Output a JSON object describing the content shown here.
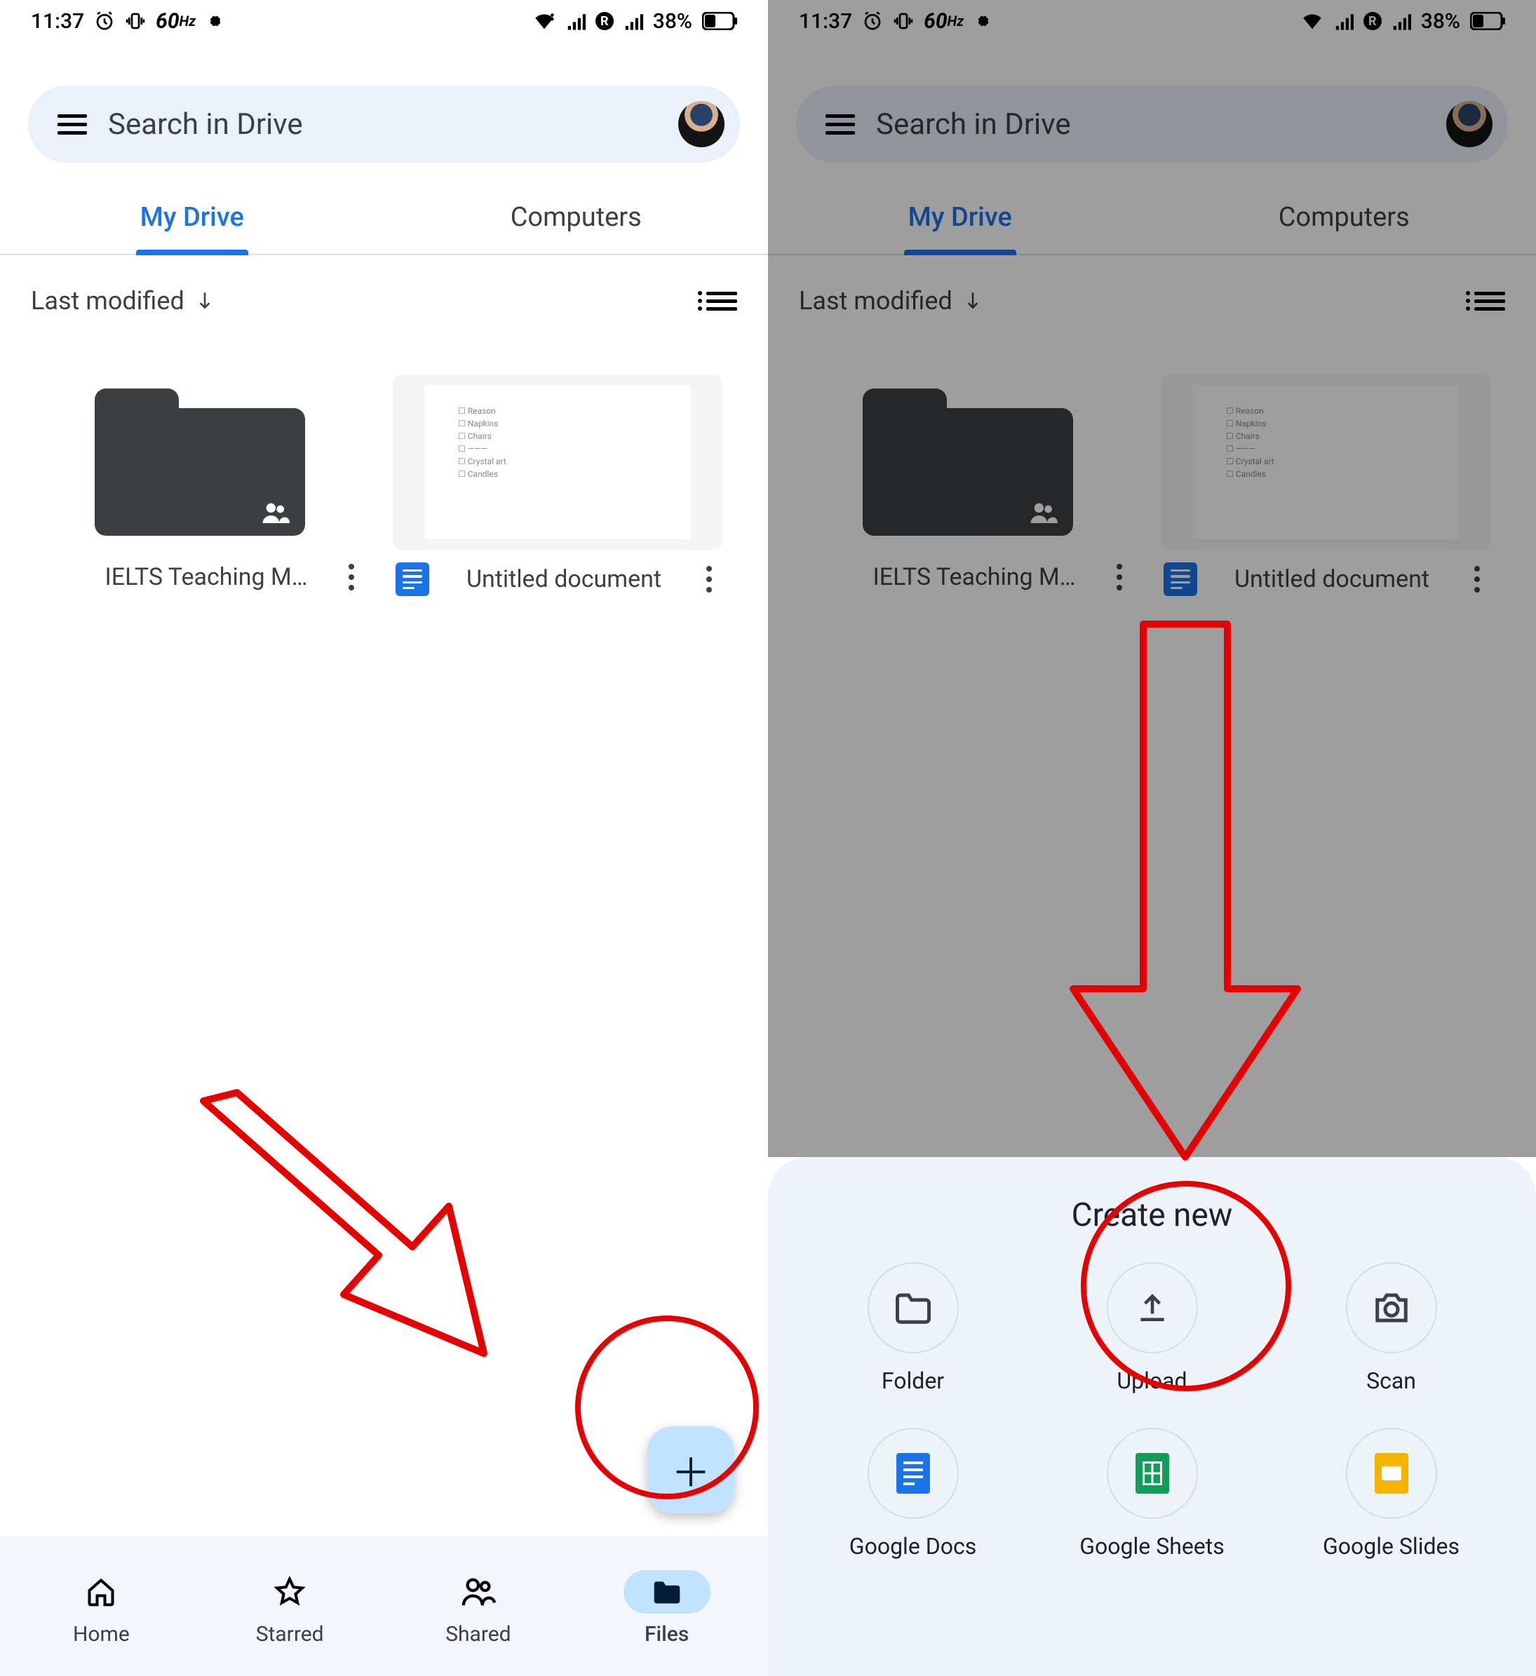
{
  "status": {
    "time": "11:37",
    "refresh_rate": "60",
    "refresh_unit": "Hz",
    "roaming": "R",
    "battery_pct": "38%"
  },
  "search": {
    "placeholder": "Search in Drive"
  },
  "tabs": {
    "my_drive": "My Drive",
    "computers": "Computers"
  },
  "sort": {
    "label": "Last modified"
  },
  "items": [
    {
      "name": "IELTS Teaching M…"
    },
    {
      "name": "Untitled document"
    }
  ],
  "nav": {
    "home": "Home",
    "starred": "Starred",
    "shared": "Shared",
    "files": "Files"
  },
  "sheet": {
    "title": "Create new",
    "folder": "Folder",
    "upload": "Upload",
    "scan": "Scan",
    "docs": "Google Docs",
    "sheets": "Google Sheets",
    "slides": "Google Slides"
  },
  "doc_preview_lines": "☐ Reason\n☐ Napkins\n☐ Chairs\n☐ ———\n☐ Crystal art\n☐ Candles"
}
